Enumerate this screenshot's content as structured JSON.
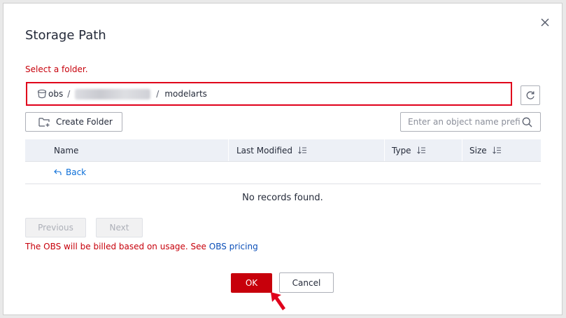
{
  "dialog": {
    "title": "Storage Path",
    "hint": "Select a folder."
  },
  "path": {
    "root": "obs",
    "separator": "/",
    "current": "modelarts"
  },
  "toolbar": {
    "create_folder_label": "Create Folder",
    "search_placeholder": "Enter an object name prefix"
  },
  "table": {
    "columns": [
      "Name",
      "Last Modified",
      "Type",
      "Size"
    ],
    "back_label": "Back",
    "empty_text": "No records found."
  },
  "pagination": {
    "previous_label": "Previous",
    "next_label": "Next"
  },
  "billing": {
    "text": "The OBS will be billed based on usage. See ",
    "link": "OBS pricing"
  },
  "footer": {
    "ok_label": "OK",
    "cancel_label": "Cancel"
  },
  "colors": {
    "accent": "#c7000b",
    "link": "#0b6ed8",
    "annotation_red": "#e0001b"
  },
  "icons": {
    "close": "close-icon",
    "bucket": "bucket-icon",
    "refresh": "refresh-icon",
    "create_folder": "folder-add-icon",
    "search": "search-icon",
    "sort": "sort-icon",
    "back": "back-arrow-icon",
    "pointer": "annotation-arrow-icon"
  }
}
